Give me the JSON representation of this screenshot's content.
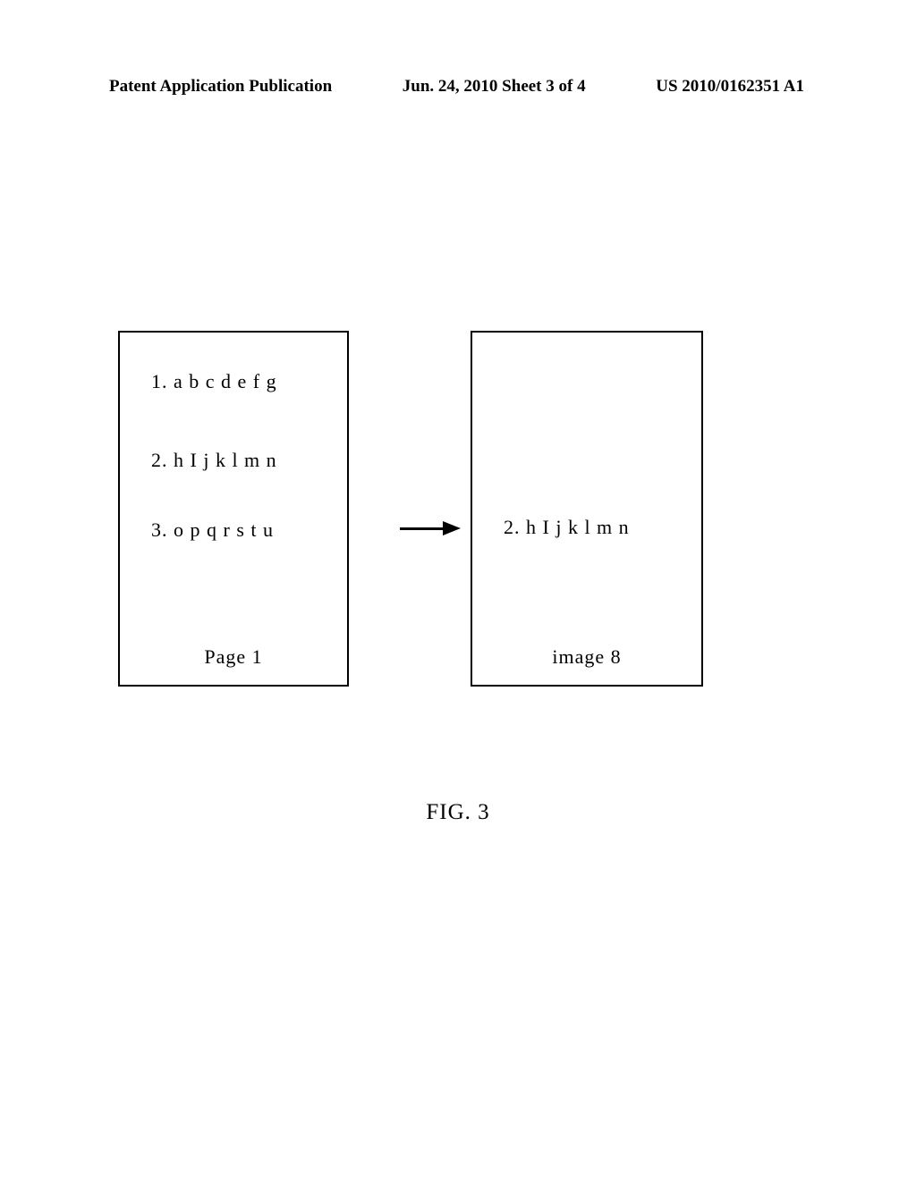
{
  "header": {
    "left": "Patent Application Publication",
    "center": "Jun. 24, 2010 Sheet 3 of 4",
    "right": "US 2010/0162351 A1"
  },
  "diagram": {
    "left_box": {
      "line1": "1. a b c d e f g",
      "line2": "2. h I j k l m n",
      "line3": "3. o p q r s t u",
      "label": "Page 1"
    },
    "right_box": {
      "line2": "2. h I j k l m n",
      "label": "image 8"
    }
  },
  "figure_label": "FIG. 3"
}
